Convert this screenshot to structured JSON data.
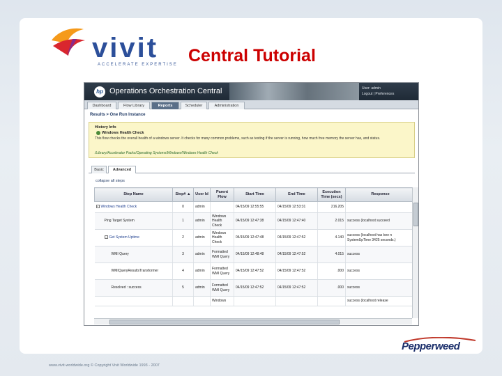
{
  "slide": {
    "title": "Central Tutorial",
    "logo_text": "vivit",
    "logo_tagline": "ACCELERATE EXPERTISE",
    "footer": "www.vivit-worldwide.org  ©  Copyright Vivit Worldwide 1993 - 2007",
    "brand": "Pepperweed"
  },
  "app": {
    "name": "Operations Orchestration Central",
    "hp_mark": "hp",
    "user_line1": "User: admin",
    "user_line2": "Logout | Preferences",
    "nav_tabs": [
      {
        "label": "Dashboard"
      },
      {
        "label": "Flow Library"
      },
      {
        "label": "Reports"
      },
      {
        "label": "Scheduler"
      },
      {
        "label": "Administration"
      }
    ],
    "breadcrumb": "Results > One Run Instance",
    "info": {
      "history": "History Info",
      "flow_name": "Windows Health Check",
      "description": "This flow checks the overall health of a windows server. It checks for many common problems, such as testing if the server is running, how much free memory the server has, and status.",
      "path": "/Library/Accelerator Packs/Operating Systems/Windows/Windows Health Check"
    },
    "sub_tabs": [
      {
        "label": "Basic"
      },
      {
        "label": "Advanced"
      }
    ],
    "collapse_label": "collapse all steps",
    "columns": [
      "Step Name",
      "Step# ▲",
      "User Id",
      "Parent Flow",
      "Start Time",
      "End Time",
      "Execution Time (secs)",
      "Response"
    ],
    "rows": [
      {
        "step": "Windows Health Check",
        "num": "0",
        "user": "admin",
        "parent": "",
        "start": "04/15/09 12:55:55",
        "end": "04/15/09 12:53:31",
        "exec": "216.205",
        "response": ""
      },
      {
        "step": "Ping Target System",
        "num": "1",
        "user": "admin",
        "parent": "Windows Health Check",
        "start": "04/15/09 12:47:38",
        "end": "04/15/09 12:47:40",
        "exec": "2.015",
        "response": "success (localhost succeed"
      },
      {
        "step": "Get System Uptime",
        "num": "2",
        "user": "admin",
        "parent": "Windows Health Check",
        "start": "04/15/09 12:47:48",
        "end": "04/15/09 12:47:52",
        "exec": "4.140",
        "response": "success (localhost has bee n SystemUpTime 3425 seconds.)"
      },
      {
        "step": "WMI Query",
        "num": "3",
        "user": "admin",
        "parent": "Formatted WMI Query",
        "start": "04/15/09 12:48:48",
        "end": "04/15/09 12:47:52",
        "exec": "4.015",
        "response": "success"
      },
      {
        "step": "WMIQueryResultsTransformer",
        "num": "4",
        "user": "admin",
        "parent": "Formatted WMI Query",
        "start": "04/15/09 12:47:52",
        "end": "04/15/09 12:47:52",
        "exec": ".000",
        "response": "success"
      },
      {
        "step": "Resolved : success",
        "num": "5",
        "user": "admin",
        "parent": "Formatted WMI Query",
        "start": "04/15/09 12:47:52",
        "end": "04/15/09 12:47:52",
        "exec": ".000",
        "response": "success"
      },
      {
        "step": "",
        "num": "",
        "user": "",
        "parent": "Windows",
        "start": "",
        "end": "",
        "exec": "",
        "response": "success (localhost release"
      }
    ]
  }
}
